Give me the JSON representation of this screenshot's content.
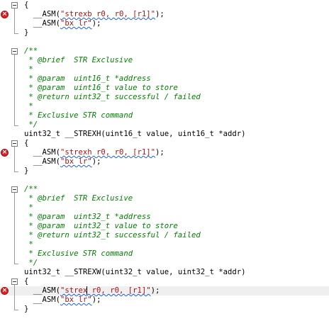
{
  "editor": {
    "lines": [
      {
        "text": "{",
        "kind": "code"
      },
      {
        "text": "  __ASM(\"strexb r0, r0, [r1]\");",
        "kind": "asm",
        "error": true
      },
      {
        "text": "  __ASM(\"bx lr\");",
        "kind": "asm"
      },
      {
        "text": "}",
        "kind": "code"
      },
      {
        "text": "",
        "kind": "blank"
      },
      {
        "text": "/**",
        "kind": "comment"
      },
      {
        "text": " * @brief  STR Exclusive",
        "kind": "comment"
      },
      {
        "text": " *",
        "kind": "comment"
      },
      {
        "text": " * @param  uint16_t *address",
        "kind": "comment"
      },
      {
        "text": " * @param  uint16_t value to store",
        "kind": "comment"
      },
      {
        "text": " * @return uint32_t successful / failed",
        "kind": "comment"
      },
      {
        "text": " *",
        "kind": "comment"
      },
      {
        "text": " * Exclusive STR command",
        "kind": "comment"
      },
      {
        "text": " */",
        "kind": "comment"
      },
      {
        "text": "uint32_t __STREXH(uint16_t value, uint16_t *addr)",
        "kind": "code"
      },
      {
        "text": "{",
        "kind": "code"
      },
      {
        "text": "  __ASM(\"strexh r0, r0, [r1]\");",
        "kind": "asm",
        "error": true
      },
      {
        "text": "  __ASM(\"bx lr\");",
        "kind": "asm"
      },
      {
        "text": "}",
        "kind": "code"
      },
      {
        "text": "",
        "kind": "blank"
      },
      {
        "text": "/**",
        "kind": "comment"
      },
      {
        "text": " * @brief  STR Exclusive",
        "kind": "comment"
      },
      {
        "text": " *",
        "kind": "comment"
      },
      {
        "text": " * @param  uint32_t *address",
        "kind": "comment"
      },
      {
        "text": " * @param  uint32_t value to store",
        "kind": "comment"
      },
      {
        "text": " * @return uint32_t successful / failed",
        "kind": "comment"
      },
      {
        "text": " *",
        "kind": "comment"
      },
      {
        "text": " * Exclusive STR command",
        "kind": "comment"
      },
      {
        "text": " */",
        "kind": "comment"
      },
      {
        "text": "uint32_t __STREXW(uint32_t value, uint32_t *addr)",
        "kind": "code"
      },
      {
        "text": "{",
        "kind": "code"
      },
      {
        "text": "  __ASM(\"strex r0, r0, [r1]\");",
        "kind": "asm",
        "error": true,
        "current": true
      },
      {
        "text": "  __ASM(\"bx lr\");",
        "kind": "asm"
      },
      {
        "text": "}",
        "kind": "code"
      }
    ]
  },
  "colors": {
    "comment": "#008000",
    "string": "#a31515",
    "error": "#d8232a",
    "squiggle": "#1f5fd6"
  },
  "icons": {
    "error_marker": "error-x-icon",
    "fold_toggle": "collapse-minus-icon"
  }
}
